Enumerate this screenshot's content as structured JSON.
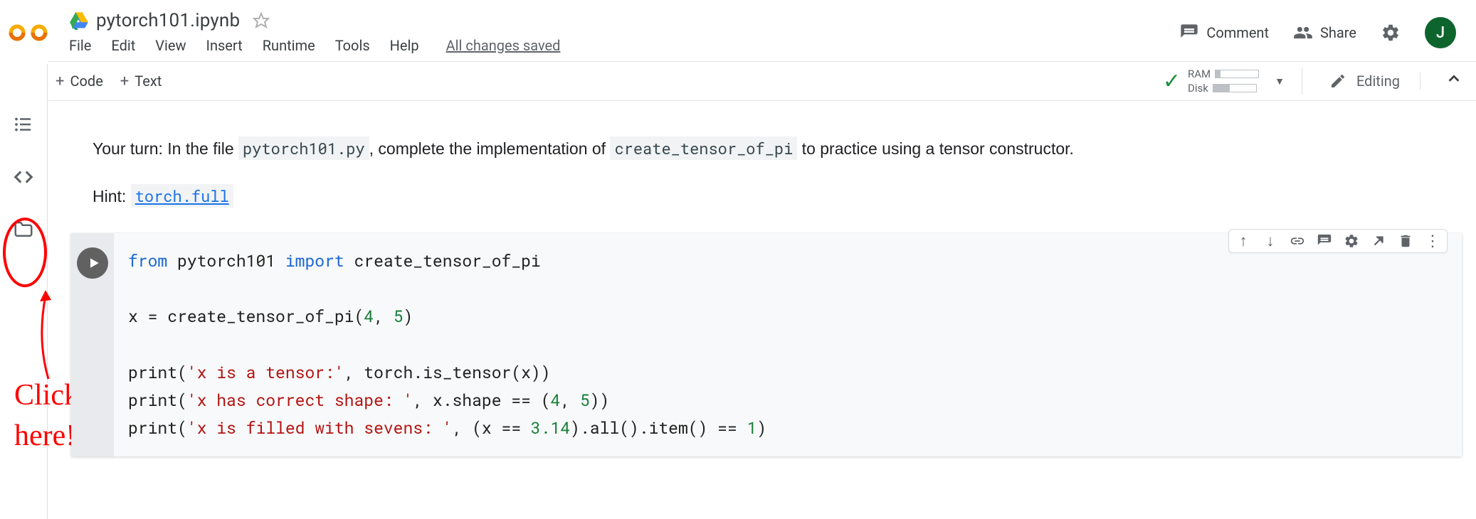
{
  "header": {
    "title": "pytorch101.ipynb",
    "avatar_initial": "J"
  },
  "menus": {
    "file": "File",
    "edit": "Edit",
    "view": "View",
    "insert": "Insert",
    "runtime": "Runtime",
    "tools": "Tools",
    "help": "Help",
    "save_status": "All changes saved"
  },
  "header_actions": {
    "comment": "Comment",
    "share": "Share"
  },
  "toolbar": {
    "code": "Code",
    "text": "Text",
    "ram": "RAM",
    "disk": "Disk",
    "editing": "Editing"
  },
  "annotation": {
    "line1": "Click",
    "line2": "here!"
  },
  "text_cell": {
    "p1_prefix": "Your turn: In the file ",
    "p1_code1": "pytorch101.py",
    "p1_mid": ", complete the implementation of ",
    "p1_code2": "create_tensor_of_pi",
    "p1_suffix": " to practice using a tensor constructor.",
    "p2_prefix": "Hint: ",
    "p2_link": "torch.full"
  },
  "code": {
    "kw_from": "from",
    "mod": " pytorch101 ",
    "kw_import": "import",
    "imp_name": " create_tensor_of_pi",
    "l2_a": "x = create_tensor_of_pi(",
    "l2_n1": "4",
    "l2_c": ", ",
    "l2_n2": "5",
    "l2_b": ")",
    "l3_a": "print(",
    "l3_s": "'x is a tensor:'",
    "l3_b": ", torch.is_tensor(x))",
    "l4_a": "print(",
    "l4_s": "'x has correct shape: '",
    "l4_b": ", x.shape == (",
    "l4_n1": "4",
    "l4_c": ", ",
    "l4_n2": "5",
    "l4_d": "))",
    "l5_a": "print(",
    "l5_s": "'x is filled with sevens: '",
    "l5_b": ", (x == ",
    "l5_n1": "3.14",
    "l5_c": ").all().item() == ",
    "l5_n2": "1",
    "l5_d": ")"
  }
}
